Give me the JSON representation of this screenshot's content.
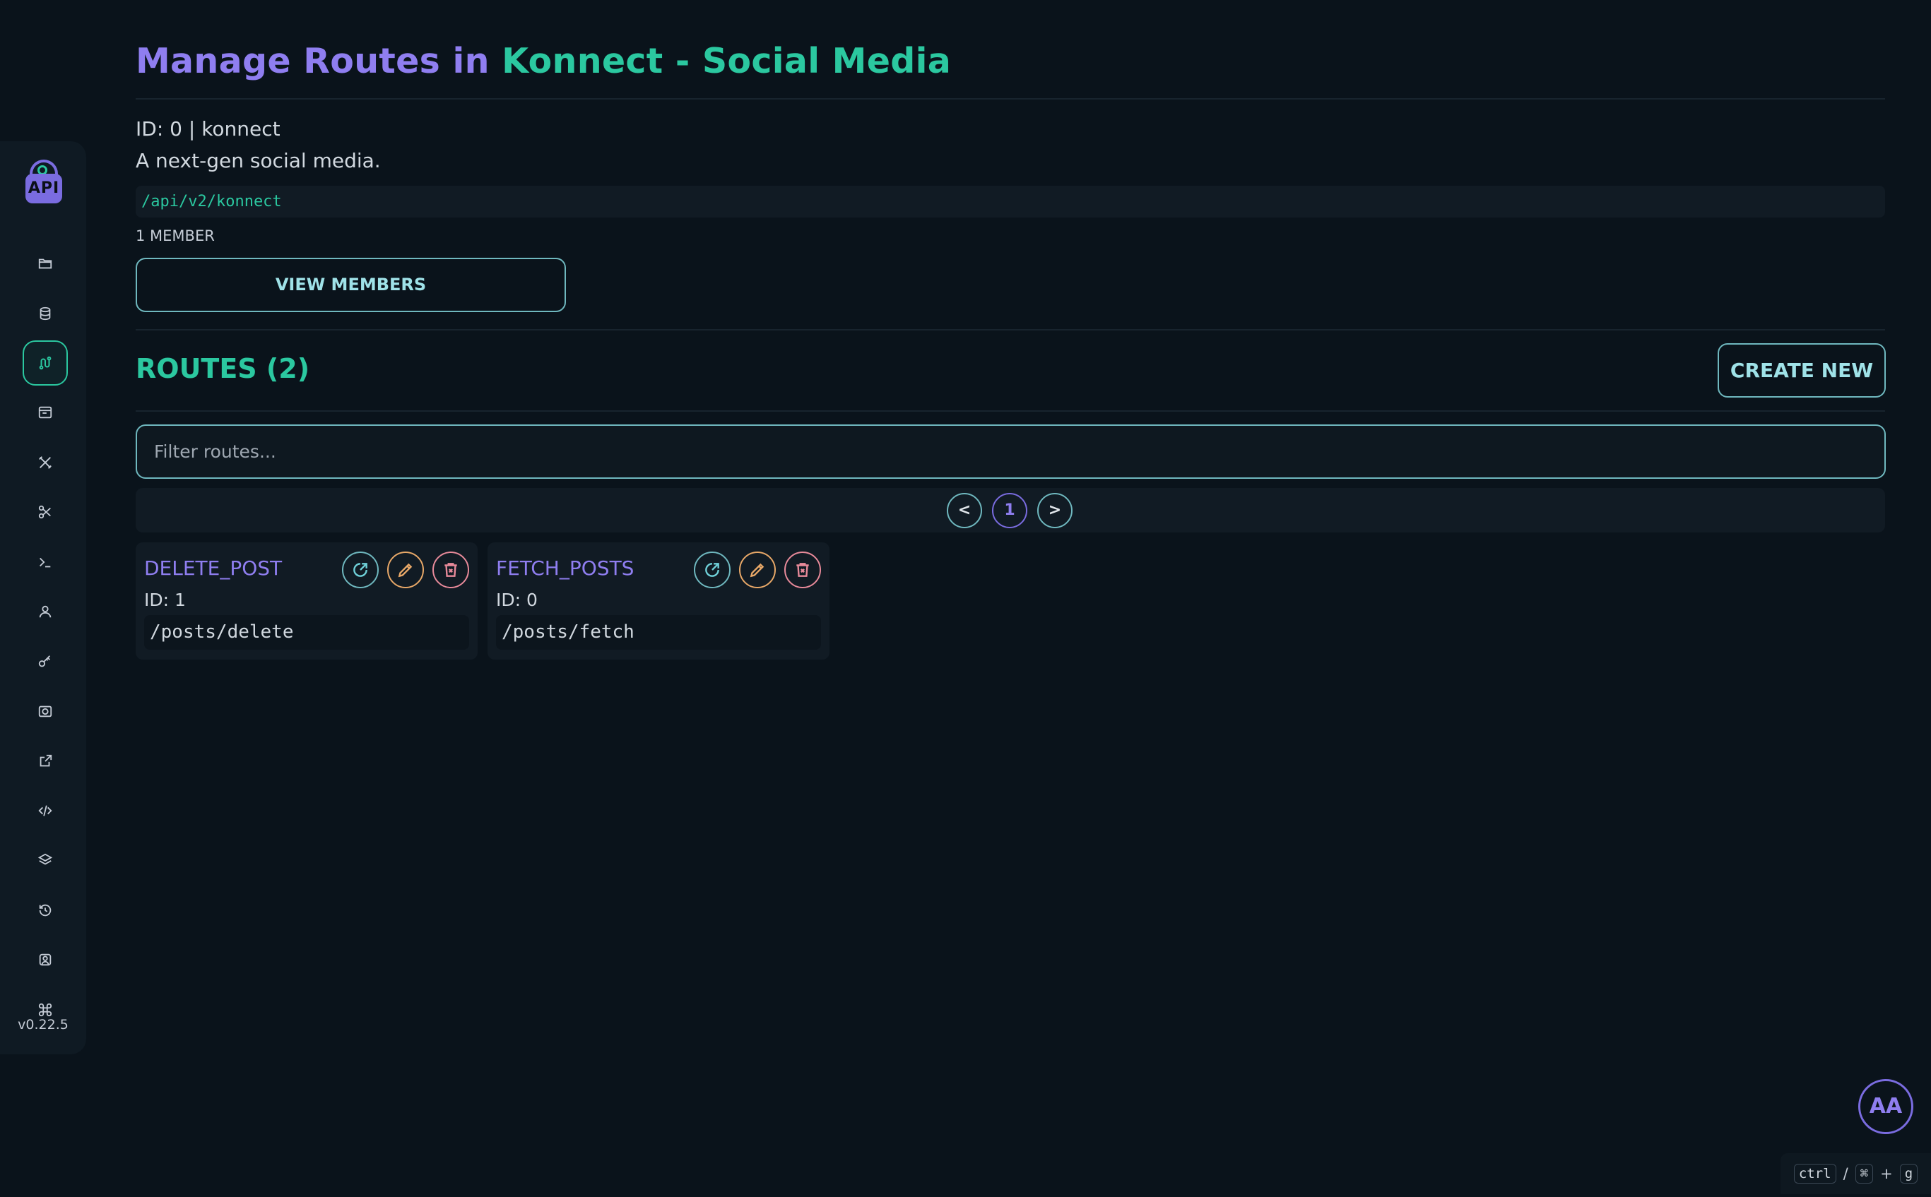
{
  "page": {
    "title_prefix": "Manage Routes in ",
    "title_project": "Konnect - Social Media",
    "id_line": "ID: 0 | konnect",
    "description": "A next-gen social media.",
    "base_path": "/api/v2/konnect",
    "member_count": "1 MEMBER",
    "view_members_label": "VIEW MEMBERS"
  },
  "routes": {
    "heading": "ROUTES (2)",
    "create_label": "CREATE NEW",
    "filter_placeholder": "Filter routes...",
    "pagination": {
      "prev": "<",
      "current": "1",
      "next": ">"
    },
    "items": [
      {
        "name": "DELETE_POST",
        "id": "ID: 1",
        "path": "/posts/delete"
      },
      {
        "name": "FETCH_POSTS",
        "id": "ID: 0",
        "path": "/posts/fetch"
      }
    ]
  },
  "sidebar": {
    "logo_text": "API",
    "version": "v0.22.5",
    "items": [
      {
        "icon": "folder-icon",
        "active": false
      },
      {
        "icon": "database-icon",
        "active": false
      },
      {
        "icon": "routes-icon",
        "active": true
      },
      {
        "icon": "browser-window-icon",
        "active": false
      },
      {
        "icon": "tools-icon",
        "active": false
      },
      {
        "icon": "scissors-icon",
        "active": false
      },
      {
        "icon": "terminal-icon",
        "active": false
      },
      {
        "icon": "user-icon",
        "active": false
      },
      {
        "icon": "key-icon",
        "active": false
      },
      {
        "icon": "camera-icon",
        "active": false
      },
      {
        "icon": "external-link-icon",
        "active": false
      },
      {
        "icon": "code-icon",
        "active": false
      },
      {
        "icon": "layers-icon",
        "active": false
      },
      {
        "icon": "history-icon",
        "active": false
      },
      {
        "icon": "user-search-icon",
        "active": false
      },
      {
        "icon": "command-icon",
        "active": false
      }
    ]
  },
  "user": {
    "initials": "AA"
  },
  "shortcut": {
    "key1": "ctrl",
    "separator": "/",
    "key2": "⌘",
    "plus": "+",
    "key3": "g"
  },
  "colors": {
    "background": "#0a131b",
    "accent_teal": "#2bc8a0",
    "accent_purple": "#8f7ef0",
    "edit_orange": "#e8a868",
    "delete_pink": "#e88a9a"
  }
}
